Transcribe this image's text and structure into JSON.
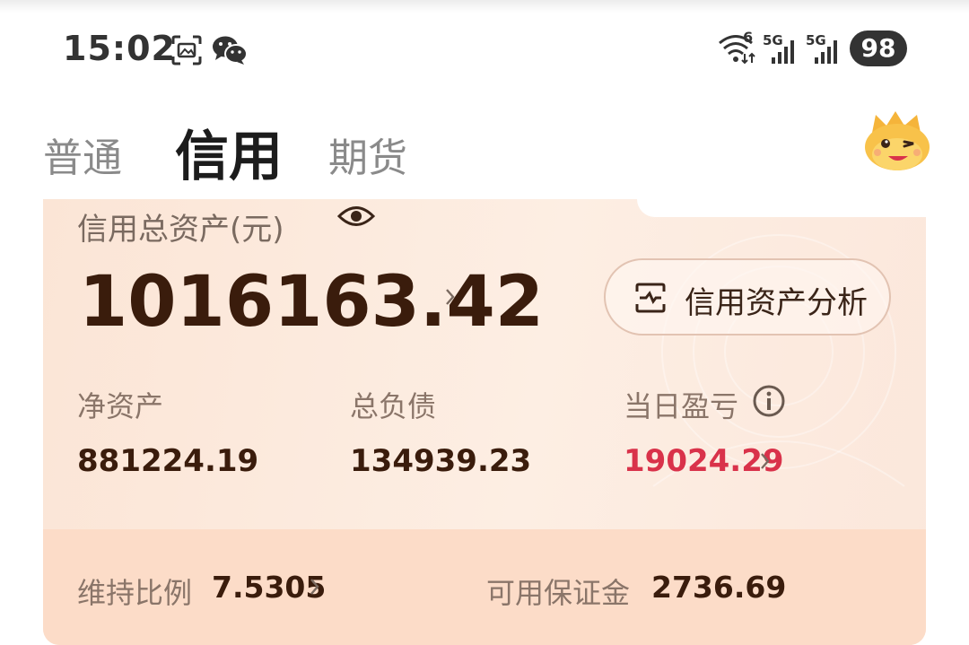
{
  "status_bar": {
    "time": "15:02",
    "battery": "98",
    "network_1": "5G",
    "network_2": "5G",
    "wifi_badge": "6",
    "icons": [
      "screenshot-icon",
      "wechat-icon",
      "wifi-icon",
      "signal-icon",
      "signal-icon",
      "battery-icon"
    ]
  },
  "tabs": {
    "items": [
      {
        "label": "普通",
        "active": false
      },
      {
        "label": "信用",
        "active": true
      },
      {
        "label": "期货",
        "active": false
      }
    ]
  },
  "card": {
    "asset_label": "信用总资产(元)",
    "asset_value": "1016163.42",
    "analysis_button": "信用资产分析",
    "net_asset_label": "净资产",
    "net_asset_value": "881224.19",
    "total_debt_label": "总负债",
    "total_debt_value": "134939.23",
    "daily_pnl_label": "当日盈亏",
    "daily_pnl_value": "19024.29",
    "maintenance_ratio_label": "维持比例",
    "maintenance_ratio_value": "7.5305",
    "available_margin_label": "可用保证金",
    "available_margin_value": "2736.69"
  },
  "colors": {
    "card_bg": "#fbe5d6",
    "card_lower_bg": "#fcdcc8",
    "value_brown": "#3a1c0c",
    "pnl_red": "#d9324a",
    "label_grey": "#8a7569"
  }
}
